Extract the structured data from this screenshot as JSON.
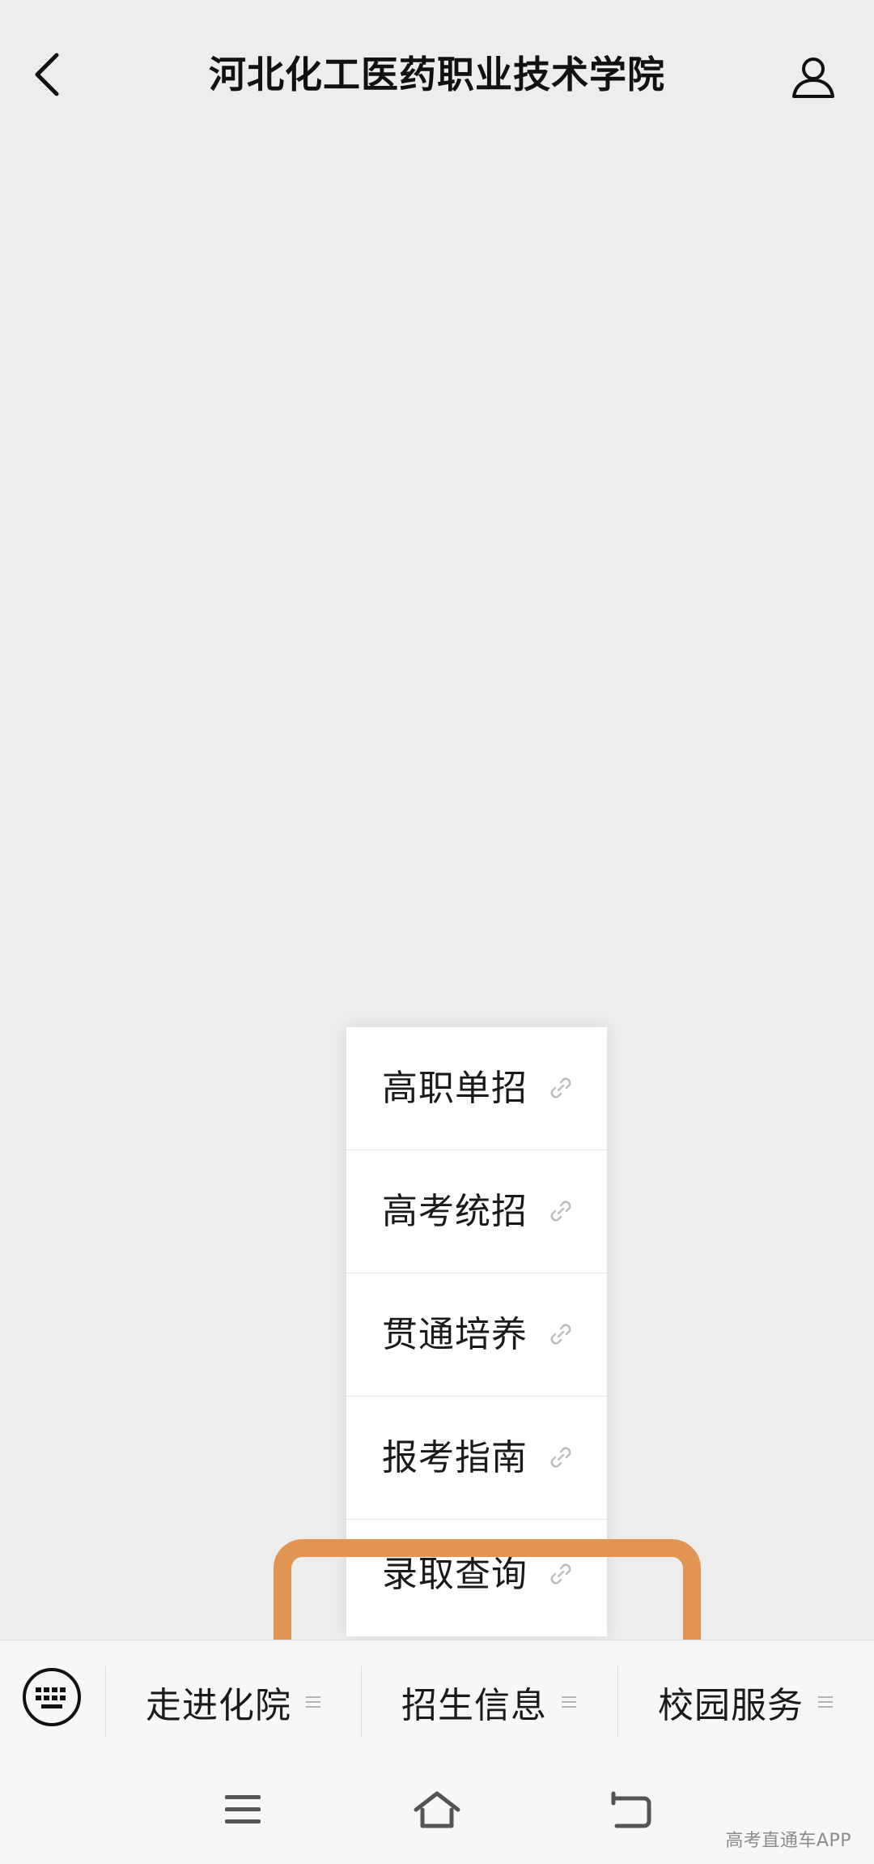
{
  "header": {
    "title": "河北化工医药职业技术学院",
    "back_icon": "chevron-left-icon",
    "profile_icon": "user-profile-icon"
  },
  "submenu": {
    "items": [
      {
        "label": "高职单招",
        "icon": "link-icon"
      },
      {
        "label": "高考统招",
        "icon": "link-icon"
      },
      {
        "label": "贯通培养",
        "icon": "link-icon"
      },
      {
        "label": "报考指南",
        "icon": "link-icon"
      },
      {
        "label": "录取查询",
        "icon": "link-icon"
      }
    ],
    "highlighted_item": "录取查询"
  },
  "menu_bar": {
    "keyboard_icon": "keyboard-icon",
    "tabs": [
      {
        "label": "走进化院",
        "icon": "menu-lines-icon"
      },
      {
        "label": "招生信息",
        "icon": "menu-lines-icon"
      },
      {
        "label": "校园服务",
        "icon": "menu-lines-icon"
      }
    ]
  },
  "system_nav": {
    "buttons": [
      "menu-icon",
      "home-icon",
      "back-icon"
    ],
    "watermark": "高考直通车APP"
  },
  "colors": {
    "background": "#ededed",
    "highlight": "#e29553",
    "menu_bar": "#f7f7f7",
    "text": "#1a1a1a"
  }
}
